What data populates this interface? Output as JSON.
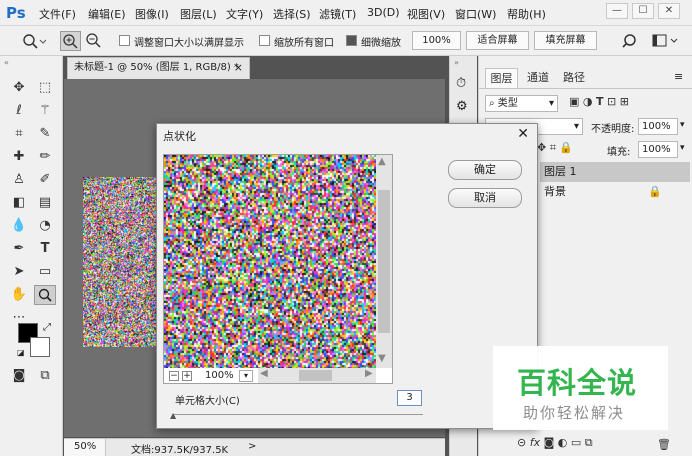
{
  "app": {
    "logo": "Ps"
  },
  "menu": [
    "文件(F)",
    "编辑(E)",
    "图像(I)",
    "图层(L)",
    "文字(Y)",
    "选择(S)",
    "滤镜(T)",
    "3D(D)",
    "视图(V)",
    "窗口(W)",
    "帮助(H)"
  ],
  "window_controls": {
    "minimize": "—",
    "maximize": "☐",
    "close": "✕"
  },
  "options_bar": {
    "resize_windows_label": "调整窗口大小以满屏显示",
    "resize_windows_checked": false,
    "zoom_all_label": "缩放所有窗口",
    "zoom_all_checked": false,
    "scrubby_zoom_label": "细微缩放",
    "scrubby_zoom_checked": true,
    "btn_100": "100%",
    "btn_fit": "适合屏幕",
    "btn_fill": "填充屏幕"
  },
  "document": {
    "tab_title": "未标题-1 @ 50% (图层 1, RGB/8) *",
    "tab_close": "×"
  },
  "status_bar": {
    "zoom": "50%",
    "doc_info": "文档:937.5K/937.5K",
    "arrow": ">"
  },
  "panel": {
    "tabs": [
      "图层",
      "通道",
      "路径"
    ],
    "filter_kind": "类型",
    "opacity_label": "不透明度:",
    "opacity_value": "100%",
    "fill_label": "填充:",
    "fill_value": "100%",
    "layers": [
      {
        "name": "图层 1",
        "selected": true,
        "locked": false
      },
      {
        "name": "背景",
        "selected": false,
        "locked": true
      }
    ]
  },
  "dialog": {
    "title": "点状化",
    "close": "✕",
    "ok": "确定",
    "cancel": "取消",
    "zoom_minus": "−",
    "zoom_plus": "+",
    "zoom_value": "100%",
    "cell_size_label": "单元格大小(C)",
    "cell_size_value": "3",
    "cell_size_fraction": 0.0
  },
  "watermark": {
    "title": "百科全说",
    "subtitle": "助你轻松解决"
  },
  "colors": {
    "chrome": "#f0f0f0",
    "workspace": "#6f6f6f",
    "accent_logo": "#1e6fc4",
    "watermark_green": "#2db34a",
    "selected_layer": "#c8c8c8"
  }
}
